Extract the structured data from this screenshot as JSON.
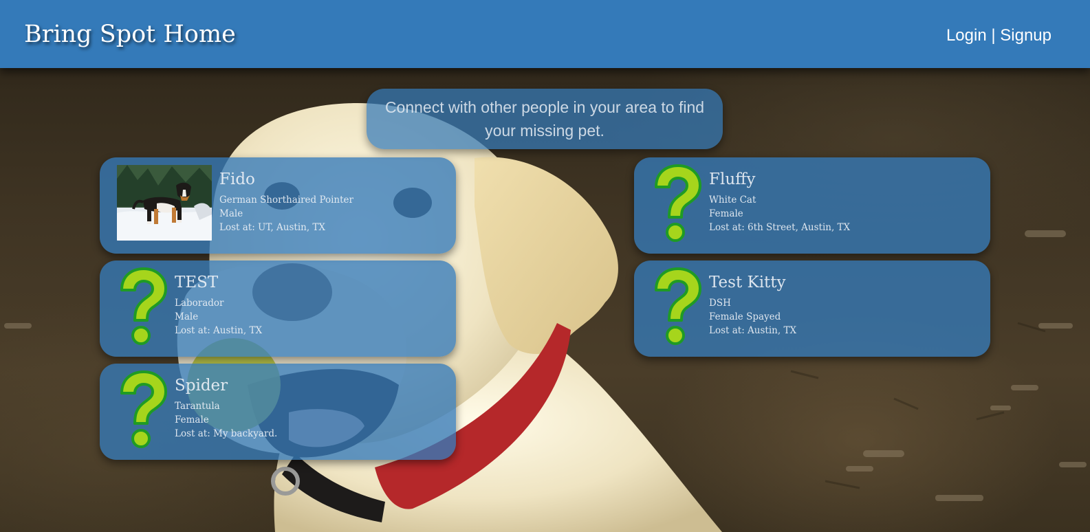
{
  "header": {
    "brand": "Bring Spot Home",
    "login_label": "Login",
    "separator": "|",
    "signup_label": "Signup",
    "bar_color": "#347ab9"
  },
  "tagline": "Connect with other people in your area to find your missing pet.",
  "pets": [
    {
      "name": "Fido",
      "breed": "German Shorthaired Pointer",
      "sex": "Male",
      "lost_at": "Lost at: UT, Austin, TX",
      "image": "dog-photo"
    },
    {
      "name": "Fluffy",
      "breed": "White Cat",
      "sex": "Female",
      "lost_at": "Lost at: 6th Street, Austin, TX",
      "image": "question-mark-icon"
    },
    {
      "name": "TEST",
      "breed": "Laborador",
      "sex": "Male",
      "lost_at": "Lost at: Austin, TX",
      "image": "question-mark-icon"
    },
    {
      "name": "Test Kitty",
      "breed": "DSH",
      "sex": "Female Spayed",
      "lost_at": "Lost at: Austin, TX",
      "image": "question-mark-icon"
    },
    {
      "name": "Spider",
      "breed": "Tarantula",
      "sex": "Female",
      "lost_at": "Lost at: My backyard.",
      "image": "question-mark-icon"
    }
  ],
  "colors": {
    "card": "#347ab9",
    "question_mark_fill": "#9ed11a",
    "question_mark_outline": "#1e9a1e"
  }
}
